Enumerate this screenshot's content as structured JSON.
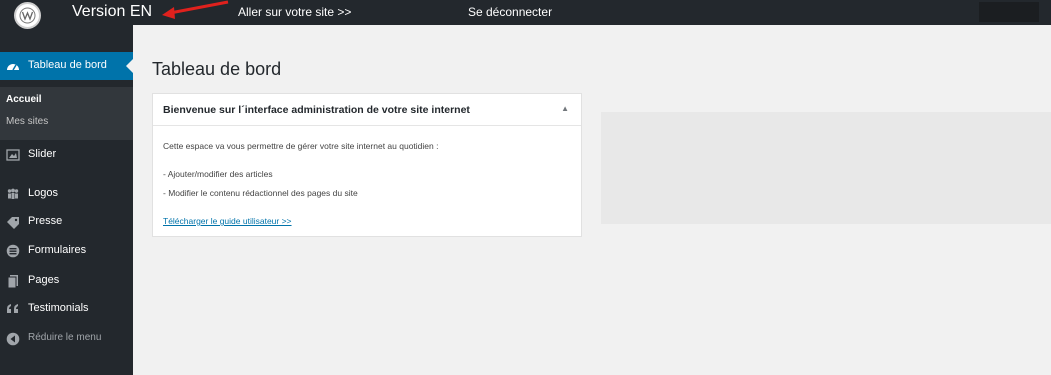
{
  "topbar": {
    "version_label": "Version EN",
    "visit_site": "Aller sur votre site >>",
    "logout": "Se déconnecter"
  },
  "sidebar": {
    "dashboard": "Tableau de bord",
    "submenu": [
      "Accueil",
      "Mes sites"
    ],
    "items": [
      "Slider",
      "Logos",
      "Presse",
      "Formulaires",
      "Pages",
      "Testimonials"
    ],
    "collapse": "Réduire le menu"
  },
  "main": {
    "page_title": "Tableau de bord",
    "welcome": {
      "title": "Bienvenue sur l´interface administration de votre site internet",
      "toggle": "▲",
      "intro": "Cette espace va vous permettre de gérer votre site internet au quotidien :",
      "bullet1": "- Ajouter/modifier des articles",
      "bullet2": "- Modifier le contenu rédactionnel des pages du site",
      "guide_link": "Télécharger le guide utilisateur >>"
    }
  },
  "colors": {
    "adminbar": "#23282d",
    "accent": "#0073aa",
    "annotation_arrow": "#e0211d"
  }
}
